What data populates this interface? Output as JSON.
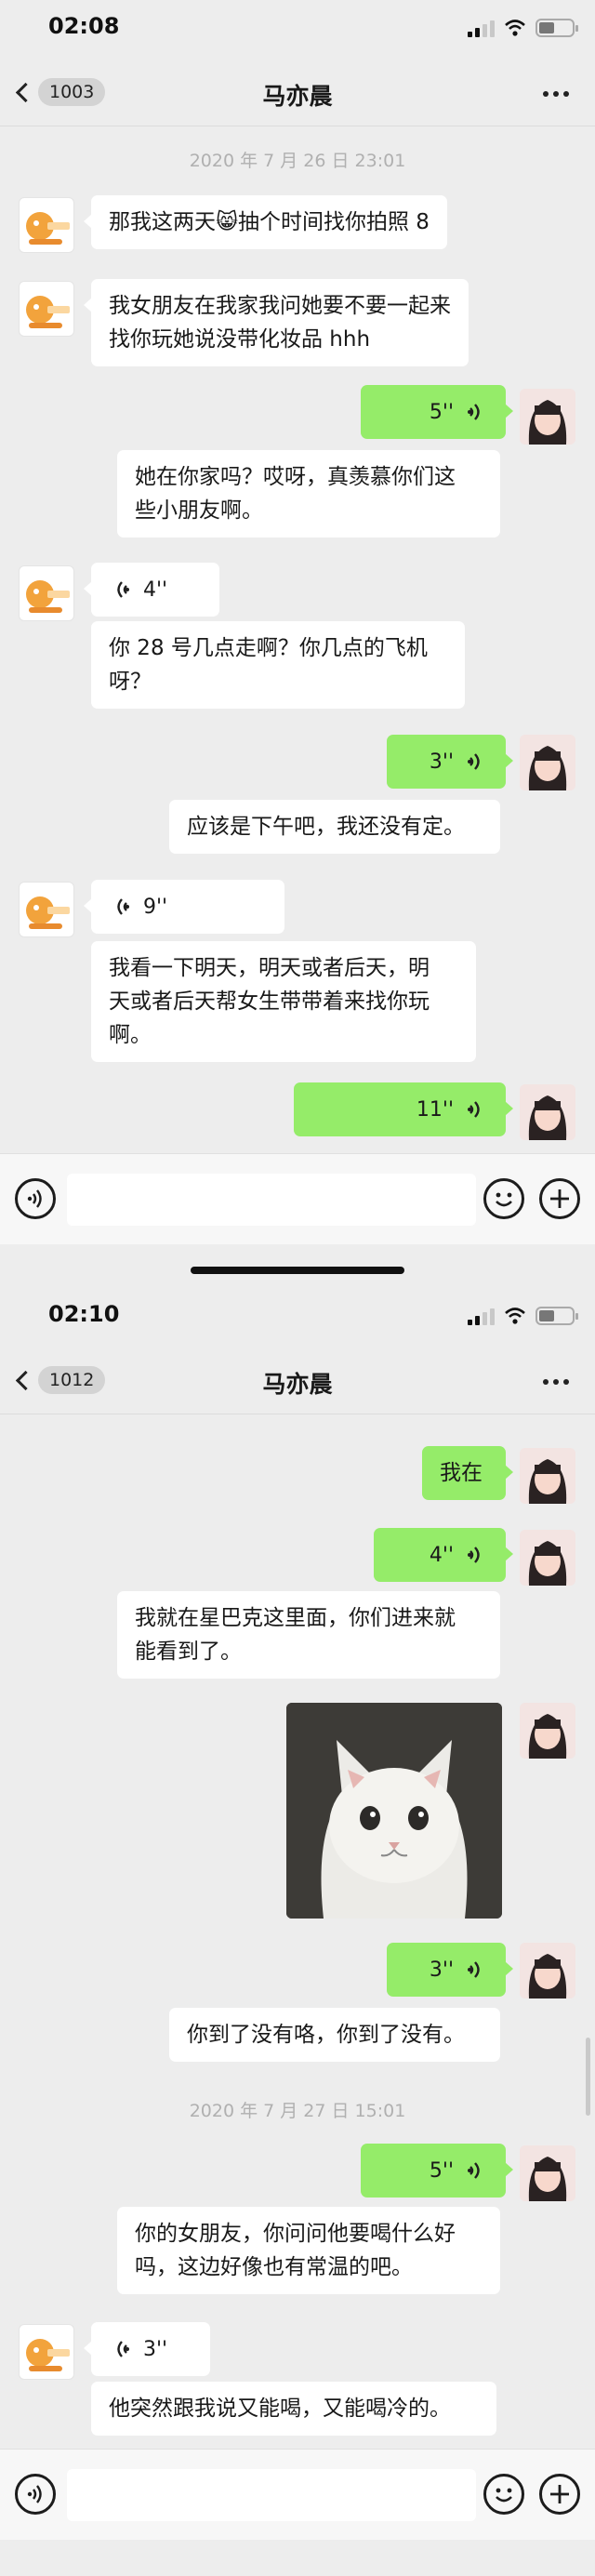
{
  "screens": [
    {
      "status_time": "02:08",
      "back_count": "1003",
      "chat_title": "马亦晨",
      "stamps": [
        "2020 年 7 月 26 日 23:01"
      ],
      "messages": [
        {
          "side": "left",
          "type": "text",
          "text": "那我这两天😸抽个时间找你拍照 8"
        },
        {
          "side": "left",
          "type": "text",
          "text": "我女朋友在我家我问她要不要一起来\n找你玩她说没带化妆品 hhh"
        },
        {
          "side": "right",
          "type": "voice",
          "text": "5''"
        },
        {
          "side": "right",
          "type": "transcript",
          "text": "她在你家吗？哎呀，真羡慕你们这\n些小朋友啊。"
        },
        {
          "side": "left",
          "type": "voice",
          "text": "4''"
        },
        {
          "side": "left",
          "type": "transcript",
          "text": "你 28 号几点走啊？你几点的飞机\n呀？"
        },
        {
          "side": "right",
          "type": "voice",
          "text": "3''"
        },
        {
          "side": "right",
          "type": "transcript",
          "text": "应该是下午吧，我还没有定。"
        },
        {
          "side": "left",
          "type": "voice",
          "text": "9''"
        },
        {
          "side": "left",
          "type": "transcript",
          "text": "我看一下明天，明天或者后天，明\n天或者后天帮女生带带着来找你玩\n啊。"
        },
        {
          "side": "right",
          "type": "voice",
          "text": "11''"
        }
      ]
    },
    {
      "status_time": "02:10",
      "back_count": "1012",
      "chat_title": "马亦晨",
      "stamps": [
        "2020 年 7 月 27 日 15:01"
      ],
      "messages": [
        {
          "side": "right",
          "type": "text",
          "text": "我在"
        },
        {
          "side": "right",
          "type": "voice",
          "text": "4''"
        },
        {
          "side": "right",
          "type": "transcript",
          "text": "我就在星巴克这里面，你们进来就\n能看到了。"
        },
        {
          "side": "right",
          "type": "image",
          "text": "white-cat-photo"
        },
        {
          "side": "right",
          "type": "voice",
          "text": "3''"
        },
        {
          "side": "right",
          "type": "transcript",
          "text": "你到了没有咯，你到了没有。"
        },
        {
          "side": "right",
          "type": "voice",
          "text": "5''"
        },
        {
          "side": "right",
          "type": "transcript",
          "text": "你的女朋友，你问问他要喝什么好\n吗，这边好像也有常温的吧。"
        },
        {
          "side": "left",
          "type": "voice",
          "text": "3''"
        },
        {
          "side": "left",
          "type": "transcript",
          "text": "他突然跟我说又能喝，又能喝冷的。"
        }
      ]
    }
  ],
  "icons": {
    "voice_toggle": "voice-input-icon",
    "emoji": "emoji-icon",
    "plus": "add-icon",
    "more": "more-options-icon",
    "back": "back-chevron-icon"
  },
  "colors": {
    "background": "#ededed",
    "sent_bubble": "#95ec69",
    "received_bubble": "#ffffff",
    "timestamp": "#b0b0b0"
  }
}
